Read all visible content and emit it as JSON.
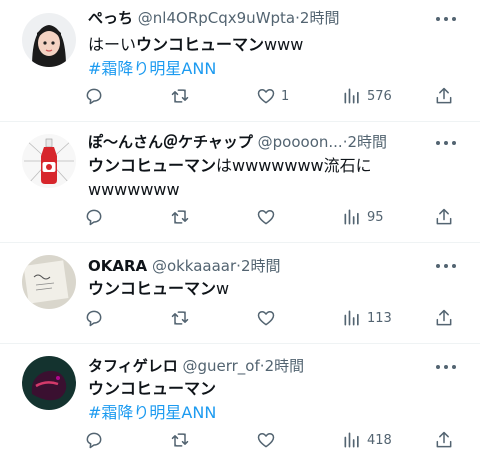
{
  "tweets": [
    {
      "name": "ぺっち",
      "handle": "@nl4ORpCqx9uWpta",
      "time": "2時間",
      "text_prefix": "はーい",
      "text_bold": "ウンコヒューマン",
      "text_suffix": "www",
      "hashtag": "#霜降り明星ANN",
      "likes": "1",
      "views": "576"
    },
    {
      "name": "ぽ〜んさん＠ケチャップ",
      "handle": "@poooon...",
      "time": "2時間",
      "text_prefix": "",
      "text_bold": "ウンコヒューマン",
      "text_suffix": "はwwwwwww流石にwwwwwww",
      "hashtag": "",
      "likes": "",
      "views": "95"
    },
    {
      "name": "OKARA",
      "handle": "@okkaaaar",
      "time": "2時間",
      "text_prefix": "",
      "text_bold": "ウンコヒューマン",
      "text_suffix": "w",
      "hashtag": "",
      "likes": "",
      "views": "113"
    },
    {
      "name": "タフィゲレロ",
      "handle": "@guerr_of",
      "time": "2時間",
      "text_prefix": "",
      "text_bold": "ウンコヒューマン",
      "text_suffix": "",
      "hashtag": "#霜降り明星ANN",
      "likes": "",
      "views": "418"
    }
  ],
  "dot": "·",
  "colors": {
    "link": "#1d9bf0",
    "muted": "#536471",
    "text": "#0f1419"
  },
  "icons": [
    "reply-icon",
    "retweet-icon",
    "like-icon",
    "views-icon",
    "share-icon",
    "more-icon"
  ]
}
